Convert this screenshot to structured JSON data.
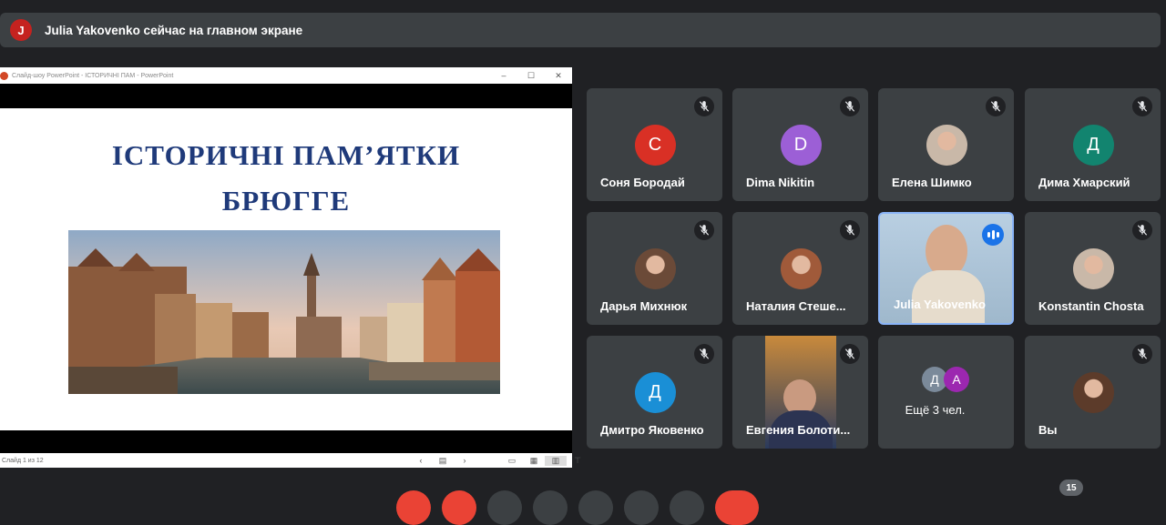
{
  "banner": {
    "avatar_letter": "J",
    "text": "Julia Yakovenko сейчас на главном экране"
  },
  "presentation": {
    "window_title": "Слайд-шоу PowerPoint  -  ІСТОРИЧНІ ПАМ  -  PowerPoint",
    "slide_title_line1": "ІСТОРИЧНІ ПАМ’ЯТКИ",
    "slide_title_line2": "БРЮГГЕ",
    "status": "Слайд 1 из 12"
  },
  "participants": [
    {
      "name": "Соня Бородай",
      "avatar": "С",
      "color": "#d93025",
      "muted": true
    },
    {
      "name": "Dima Nikitin",
      "avatar": "D",
      "color": "#9c5fd6",
      "muted": true
    },
    {
      "name": "Елена Шимко",
      "avatar": "photo",
      "muted": true
    },
    {
      "name": "Дима Хмарский",
      "avatar": "Д",
      "color": "#12846f",
      "muted": true
    },
    {
      "name": "Дарья Михнюк",
      "avatar": "photo",
      "muted": true
    },
    {
      "name": "Наталия Стеше...",
      "avatar": "photo",
      "muted": true
    },
    {
      "name": "Julia Yakovenko",
      "avatar": "video",
      "muted": false,
      "speaking": true
    },
    {
      "name": "Konstantin Chosta",
      "avatar": "photo",
      "muted": true
    },
    {
      "name": "Дмитро Яковенко",
      "avatar": "Д",
      "color": "#1a8fd6",
      "muted": true
    },
    {
      "name": "Евгения Болоти...",
      "avatar": "video",
      "muted": true
    },
    {
      "name": "Ещё 3 чел.",
      "avatars": [
        "Д",
        "А"
      ],
      "muted": false
    },
    {
      "name": "Вы",
      "avatar": "photo",
      "muted": true
    }
  ],
  "participant_count": "15",
  "colors": {
    "accent": "#1a73e8",
    "tile": "#3c4043",
    "background": "#202124"
  }
}
